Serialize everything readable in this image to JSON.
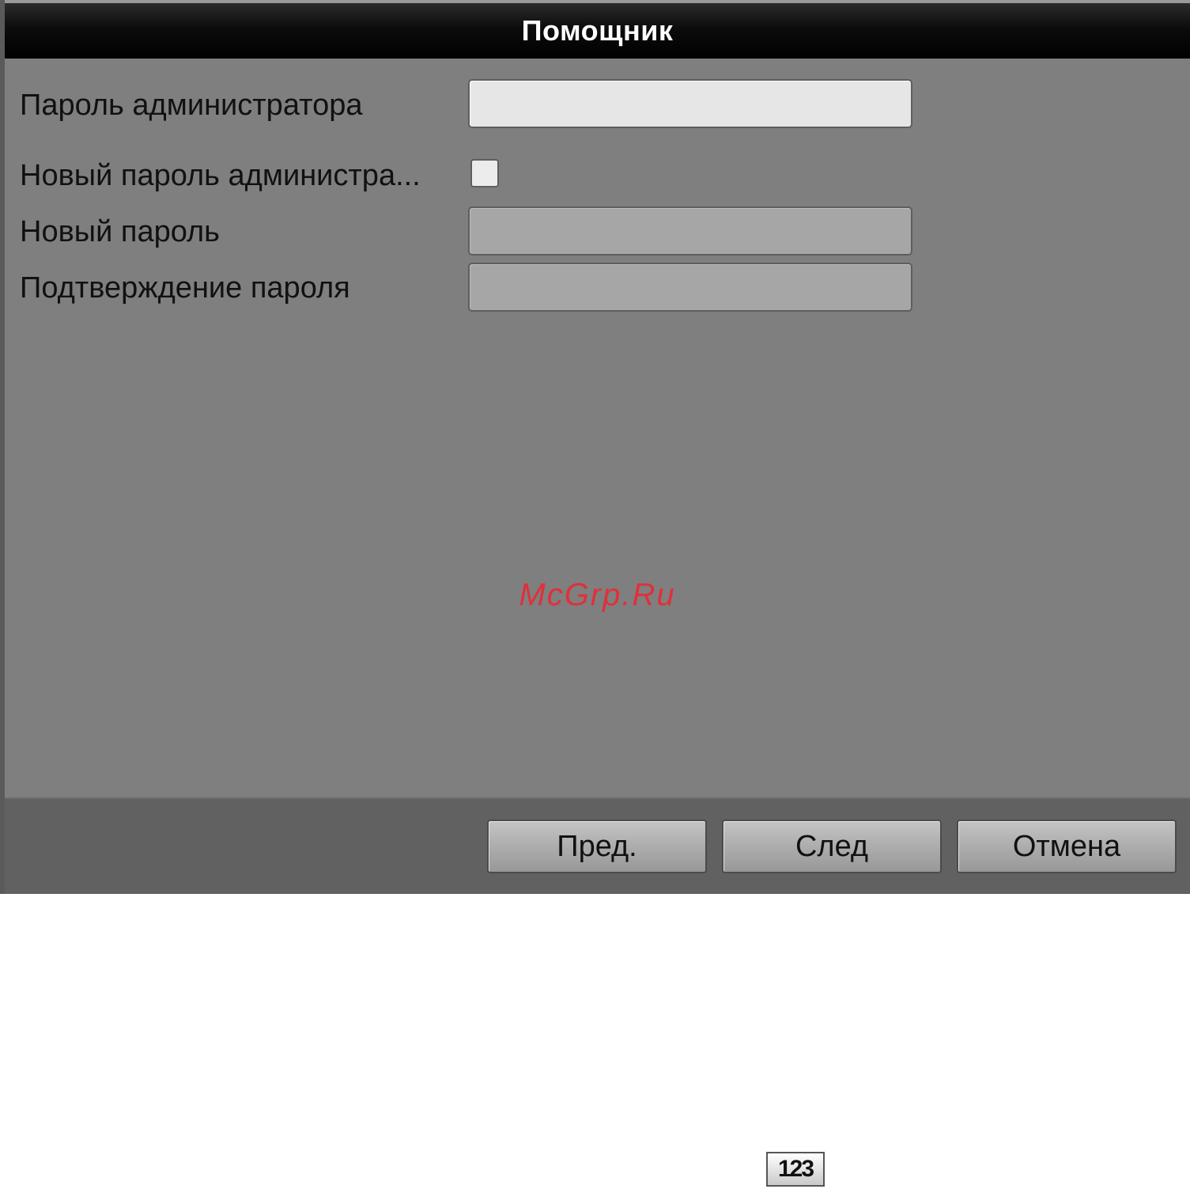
{
  "dialog": {
    "title": "Помощник"
  },
  "form": {
    "admin_password_label": "Пароль администратора",
    "admin_password_value": "",
    "new_admin_password_label": "Новый пароль администра...",
    "new_admin_password_checked": false,
    "new_password_label": "Новый пароль",
    "new_password_value": "",
    "confirm_password_label": "Подтверждение пароля",
    "confirm_password_value": ""
  },
  "watermark": {
    "text": "McGrp.Ru"
  },
  "buttons": {
    "prev_label": "Пред.",
    "next_label": "След",
    "cancel_label": "Отмена"
  },
  "icons": {
    "numpad_icon_text": "123"
  }
}
